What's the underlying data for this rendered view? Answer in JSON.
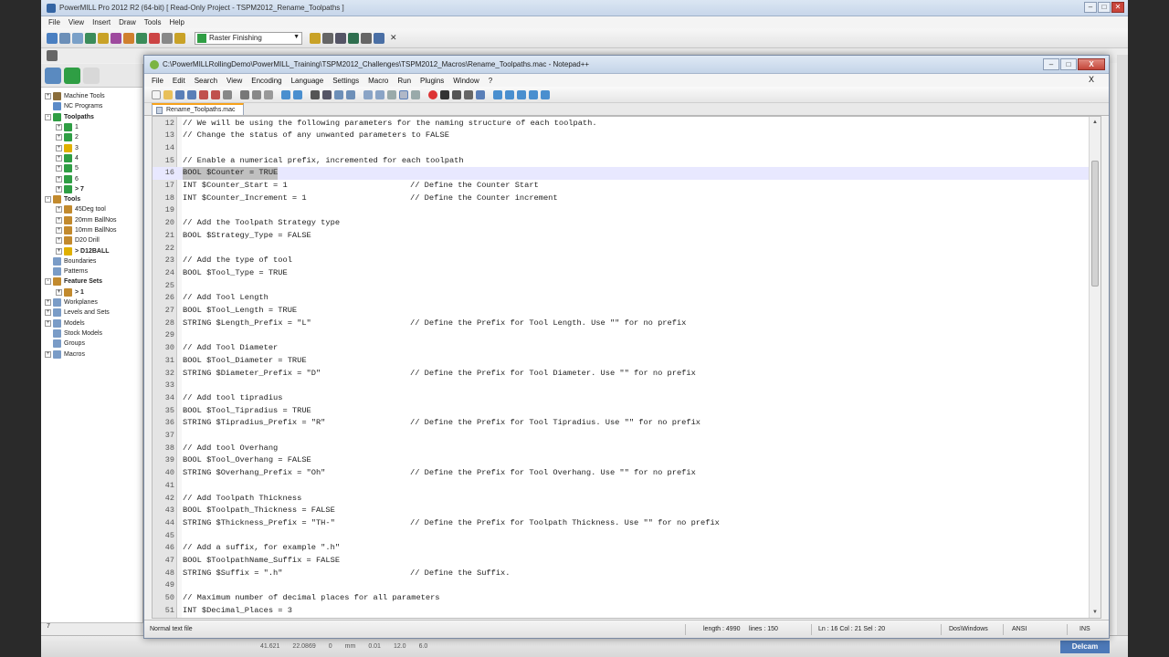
{
  "powermill": {
    "title": "PowerMILL Pro 2012 R2 (64-bit)   [ Read-Only Project - TSPM2012_Rename_Toolpaths ]",
    "menu": [
      "File",
      "View",
      "Insert",
      "Draw",
      "Tools",
      "Help"
    ],
    "strategy_select": "Raster Finishing",
    "explorer": [
      {
        "label": "Machine Tools",
        "level": 0,
        "exp": "+",
        "icon": "#8a6d3b"
      },
      {
        "label": "NC Programs",
        "level": 0,
        "exp": "",
        "icon": "#5b8bc8"
      },
      {
        "label": "Toolpaths",
        "level": 0,
        "exp": "-",
        "icon": "#2f9e44",
        "bold": true
      },
      {
        "label": "1",
        "level": 1,
        "exp": "+",
        "icon": "#2f9e44"
      },
      {
        "label": "2",
        "level": 1,
        "exp": "+",
        "icon": "#2f9e44"
      },
      {
        "label": "3",
        "level": 1,
        "exp": "+",
        "icon": "#e0b000"
      },
      {
        "label": "4",
        "level": 1,
        "exp": "+",
        "icon": "#2f9e44"
      },
      {
        "label": "5",
        "level": 1,
        "exp": "+",
        "icon": "#2f9e44"
      },
      {
        "label": "6",
        "level": 1,
        "exp": "+",
        "icon": "#2f9e44"
      },
      {
        "label": "> 7",
        "level": 1,
        "exp": "+",
        "icon": "#2f9e44",
        "bold": true
      },
      {
        "label": "Tools",
        "level": 0,
        "exp": "-",
        "icon": "#c28a2e",
        "bold": true
      },
      {
        "label": "45Deg tool",
        "level": 1,
        "exp": "+",
        "icon": "#c28a2e"
      },
      {
        "label": "20mm BallNos",
        "level": 1,
        "exp": "+",
        "icon": "#c28a2e"
      },
      {
        "label": "10mm BallNos",
        "level": 1,
        "exp": "+",
        "icon": "#c28a2e"
      },
      {
        "label": "D20 Drill",
        "level": 1,
        "exp": "+",
        "icon": "#c28a2e"
      },
      {
        "label": "> D12BALL",
        "level": 1,
        "exp": "+",
        "icon": "#e0b000",
        "bold": true
      },
      {
        "label": "Boundaries",
        "level": 0,
        "exp": "",
        "icon": "#7a9cc7"
      },
      {
        "label": "Patterns",
        "level": 0,
        "exp": "",
        "icon": "#7a9cc7"
      },
      {
        "label": "Feature Sets",
        "level": 0,
        "exp": "-",
        "icon": "#c28a2e",
        "bold": true
      },
      {
        "label": "> 1",
        "level": 1,
        "exp": "+",
        "icon": "#c28a2e",
        "bold": true
      },
      {
        "label": "Workplanes",
        "level": 0,
        "exp": "+",
        "icon": "#7a9cc7"
      },
      {
        "label": "Levels and Sets",
        "level": 0,
        "exp": "+",
        "icon": "#7a9cc7"
      },
      {
        "label": "Models",
        "level": 0,
        "exp": "+",
        "icon": "#7a9cc7"
      },
      {
        "label": "Stock Models",
        "level": 0,
        "exp": "",
        "icon": "#7a9cc7"
      },
      {
        "label": "Groups",
        "level": 0,
        "exp": "",
        "icon": "#7a9cc7"
      },
      {
        "label": "Macros",
        "level": 0,
        "exp": "+",
        "icon": "#7a9cc7"
      }
    ],
    "left_status": "7",
    "bottom_values": [
      "41.621",
      "22.0869",
      "0",
      "mm",
      "0.01",
      "12.0",
      "6.0"
    ],
    "brand": "Delcam"
  },
  "npp": {
    "title": "C:\\PowerMILLRollingDemo\\PowerMILL_Training\\TSPM2012_Challenges\\TSPM2012_Macros\\Rename_Toolpaths.mac - Notepad++",
    "menu": [
      "File",
      "Edit",
      "Search",
      "View",
      "Encoding",
      "Language",
      "Settings",
      "Macro",
      "Run",
      "Plugins",
      "Window",
      "?"
    ],
    "menu_close": "X",
    "tab_label": "Rename_Toolpaths.mac",
    "win_buttons": {
      "min": "–",
      "max": "□",
      "close": "X"
    },
    "lines": [
      {
        "n": "12",
        "code": "// We will be using the following parameters for the naming structure of each toolpath.",
        "comment": ""
      },
      {
        "n": "13",
        "code": "// Change the status of any unwanted parameters to FALSE",
        "comment": ""
      },
      {
        "n": "14",
        "code": "",
        "comment": ""
      },
      {
        "n": "15",
        "code": "// Enable a numerical prefix, incremented for each toolpath",
        "comment": ""
      },
      {
        "n": "16",
        "code": "BOOL $Counter = TRUE",
        "comment": "",
        "current": true
      },
      {
        "n": "17",
        "code": "INT $Counter_Start = 1",
        "comment": "// Define the Counter Start"
      },
      {
        "n": "18",
        "code": "INT $Counter_Increment = 1",
        "comment": "// Define the Counter increment"
      },
      {
        "n": "19",
        "code": "",
        "comment": ""
      },
      {
        "n": "20",
        "code": "// Add the Toolpath Strategy type",
        "comment": ""
      },
      {
        "n": "21",
        "code": "BOOL $Strategy_Type = FALSE",
        "comment": ""
      },
      {
        "n": "22",
        "code": "",
        "comment": ""
      },
      {
        "n": "23",
        "code": "// Add the type of tool",
        "comment": ""
      },
      {
        "n": "24",
        "code": "BOOL $Tool_Type = TRUE",
        "comment": ""
      },
      {
        "n": "25",
        "code": "",
        "comment": ""
      },
      {
        "n": "26",
        "code": "// Add Tool Length",
        "comment": ""
      },
      {
        "n": "27",
        "code": "BOOL $Tool_Length = TRUE",
        "comment": ""
      },
      {
        "n": "28",
        "code": "STRING $Length_Prefix = \"L\"",
        "comment": "// Define the Prefix for Tool Length. Use \"\" for no prefix"
      },
      {
        "n": "29",
        "code": "",
        "comment": ""
      },
      {
        "n": "30",
        "code": "// Add Tool Diameter",
        "comment": ""
      },
      {
        "n": "31",
        "code": "BOOL $Tool_Diameter = TRUE",
        "comment": ""
      },
      {
        "n": "32",
        "code": "STRING $Diameter_Prefix = \"D\"",
        "comment": "// Define the Prefix for Tool Diameter. Use \"\" for no prefix"
      },
      {
        "n": "33",
        "code": "",
        "comment": ""
      },
      {
        "n": "34",
        "code": "// Add tool tipradius",
        "comment": ""
      },
      {
        "n": "35",
        "code": "BOOL $Tool_Tipradius = TRUE",
        "comment": ""
      },
      {
        "n": "36",
        "code": "STRING $Tipradius_Prefix = \"R\"",
        "comment": "// Define the Prefix for Tool Tipradius. Use \"\" for no prefix"
      },
      {
        "n": "37",
        "code": "",
        "comment": ""
      },
      {
        "n": "38",
        "code": "// Add tool Overhang",
        "comment": ""
      },
      {
        "n": "39",
        "code": "BOOL $Tool_Overhang = FALSE",
        "comment": ""
      },
      {
        "n": "40",
        "code": "STRING $Overhang_Prefix = \"Oh\"",
        "comment": "// Define the Prefix for Tool Overhang. Use \"\" for no prefix"
      },
      {
        "n": "41",
        "code": "",
        "comment": ""
      },
      {
        "n": "42",
        "code": "// Add Toolpath Thickness",
        "comment": ""
      },
      {
        "n": "43",
        "code": "BOOL $Toolpath_Thickness = FALSE",
        "comment": ""
      },
      {
        "n": "44",
        "code": "STRING $Thickness_Prefix = \"TH-\"",
        "comment": "// Define the Prefix for Toolpath Thickness. Use \"\" for no prefix"
      },
      {
        "n": "45",
        "code": "",
        "comment": ""
      },
      {
        "n": "46",
        "code": "// Add a suffix, for example \".h\"",
        "comment": ""
      },
      {
        "n": "47",
        "code": "BOOL $ToolpathName_Suffix = FALSE",
        "comment": ""
      },
      {
        "n": "48",
        "code": "STRING $Suffix = \".h\"",
        "comment": "// Define the Suffix."
      },
      {
        "n": "49",
        "code": "",
        "comment": ""
      },
      {
        "n": "50",
        "code": "// Maximum number of decimal places for all parameters",
        "comment": ""
      },
      {
        "n": "51",
        "code": "INT $Decimal_Places = 3",
        "comment": ""
      }
    ],
    "status": {
      "file_type": "Normal text file",
      "length": "length : 4990",
      "lines": "lines : 150",
      "position": "Ln : 16   Col : 21   Sel : 20",
      "eol": "Dos\\Windows",
      "encoding": "ANSI",
      "mode": "INS"
    }
  },
  "colors": {
    "current_line": "#e8e8ff",
    "selection": "#c0c0c0",
    "tab_accent": "#f7a21b"
  }
}
